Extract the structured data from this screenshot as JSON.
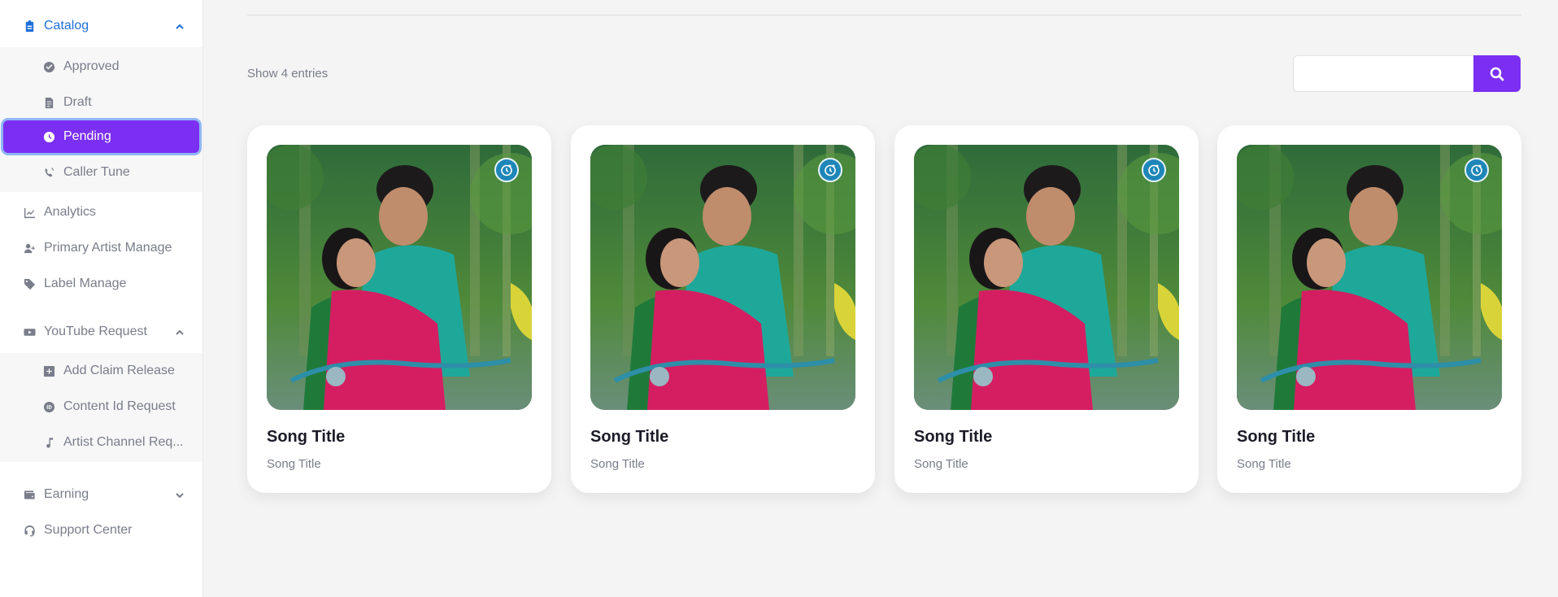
{
  "sidebar": {
    "catalog": {
      "label": "Catalog",
      "icon": "clipboard-icon"
    },
    "catalog_items": [
      {
        "label": "Approved",
        "icon": "check-circle-icon"
      },
      {
        "label": "Draft",
        "icon": "document-icon"
      },
      {
        "label": "Pending",
        "icon": "clock-icon"
      },
      {
        "label": "Caller Tune",
        "icon": "phone-volume-icon"
      }
    ],
    "analytics": {
      "label": "Analytics",
      "icon": "line-chart-icon"
    },
    "primary_artist": {
      "label": "Primary Artist Manage",
      "icon": "user-plus-icon"
    },
    "label_manage": {
      "label": "Label Manage",
      "icon": "tag-icon"
    },
    "youtube": {
      "label": "YouTube Request",
      "icon": "youtube-icon"
    },
    "youtube_items": [
      {
        "label": "Add Claim Release",
        "icon": "plus-square-icon"
      },
      {
        "label": "Content Id Request",
        "icon": "id-badge-icon"
      },
      {
        "label": "Artist Channel Req...",
        "icon": "music-note-icon"
      }
    ],
    "earning": {
      "label": "Earning",
      "icon": "wallet-icon"
    },
    "support": {
      "label": "Support Center",
      "icon": "headset-icon"
    }
  },
  "main": {
    "entries_text": "Show 4 entries",
    "search": {
      "value": "",
      "placeholder": ""
    }
  },
  "cards": [
    {
      "title": "Song Title",
      "subtitle": "Song Title",
      "status_icon": "clock-plus-icon"
    },
    {
      "title": "Song Title",
      "subtitle": "Song Title",
      "status_icon": "clock-plus-icon"
    },
    {
      "title": "Song Title",
      "subtitle": "Song Title",
      "status_icon": "clock-plus-icon"
    },
    {
      "title": "Song Title",
      "subtitle": "Song Title",
      "status_icon": "clock-plus-icon"
    }
  ],
  "colors": {
    "accent": "#7b2ff2",
    "active_blue": "#1e6fd9",
    "badge": "#1f86b8"
  }
}
